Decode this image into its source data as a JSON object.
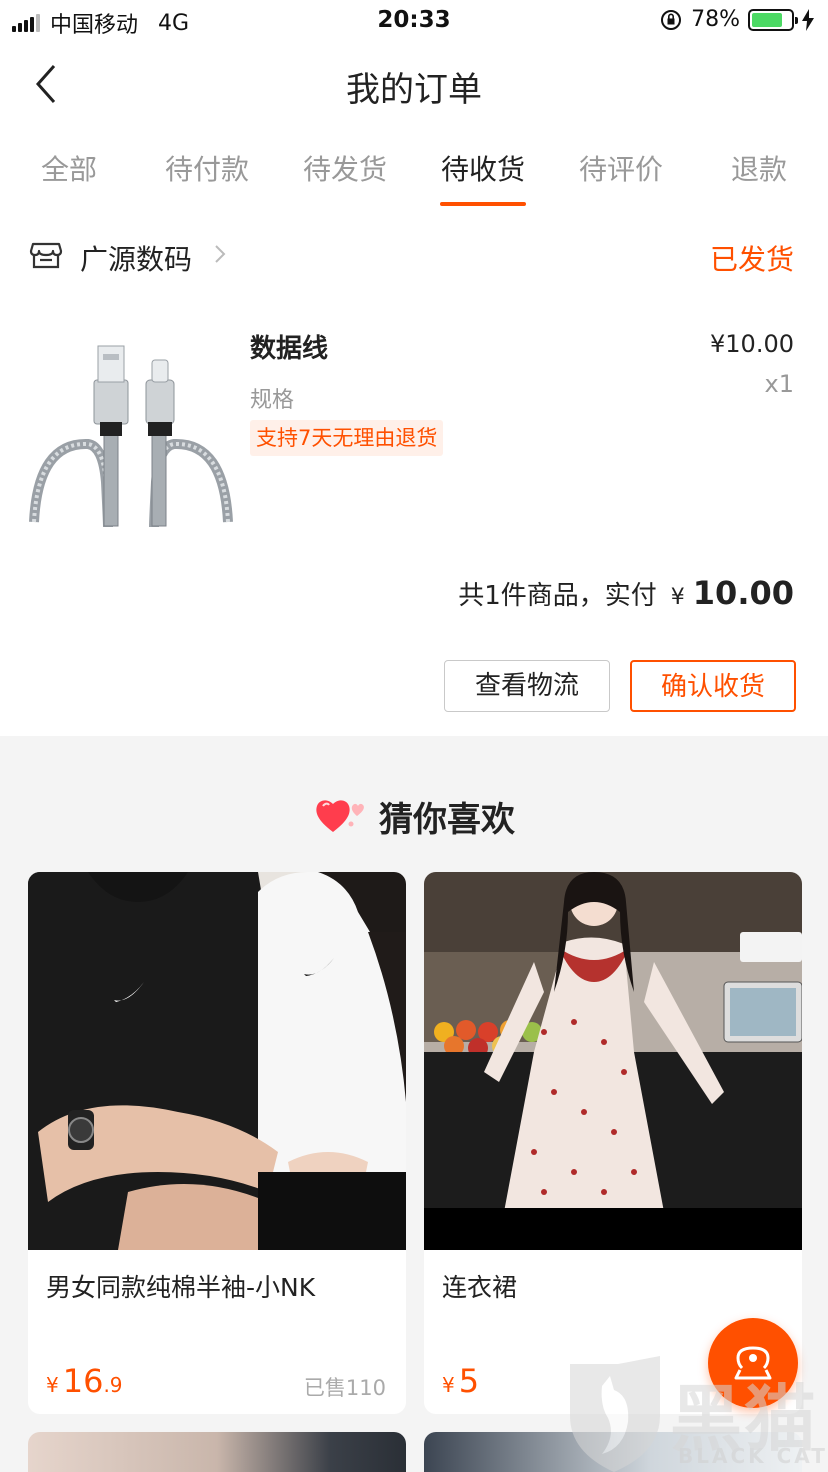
{
  "status_bar": {
    "carrier": "中国移动",
    "network": "4G",
    "time": "20:33",
    "battery_percent": "78%",
    "battery_level": 0.78
  },
  "nav": {
    "title": "我的订单"
  },
  "tabs": [
    {
      "label": "全部"
    },
    {
      "label": "待付款"
    },
    {
      "label": "待发货"
    },
    {
      "label": "待收货",
      "active": true
    },
    {
      "label": "待评价"
    },
    {
      "label": "退款"
    }
  ],
  "order": {
    "shop_name": "广源数码",
    "status": "已发货",
    "product": {
      "name": "数据线",
      "spec": "规格",
      "badge": "支持7天无理由退货",
      "price": "¥10.00",
      "quantity": "x1"
    },
    "summary_text": "共1件商品，实付",
    "summary_currency": "¥",
    "summary_amount": "10.00",
    "actions": {
      "logistics": "查看物流",
      "confirm": "确认收货"
    }
  },
  "recommend": {
    "title": "猜你喜欢",
    "items": [
      {
        "name": "男女同款纯棉半袖-小NK",
        "currency": "¥",
        "price_int": "16",
        "price_dec": ".9",
        "sold": "已售110"
      },
      {
        "name": "连衣裙",
        "currency": "¥",
        "price_int": "5",
        "price_dec": "",
        "sold": ""
      }
    ]
  },
  "watermark": {
    "text": "黑猫",
    "sub": "BLACK CAT"
  },
  "colors": {
    "accent": "#ff5000",
    "battery": "#4cd964"
  }
}
